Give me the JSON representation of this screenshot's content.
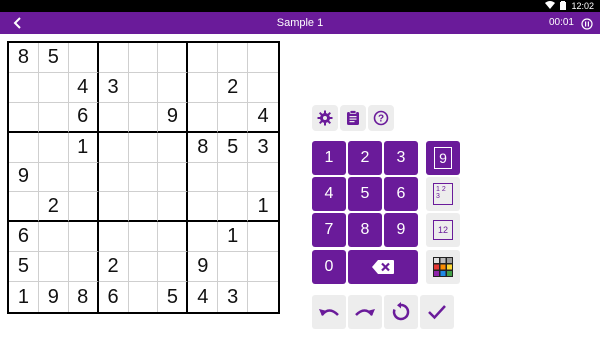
{
  "status_bar": {
    "time": "12:02"
  },
  "app_bar": {
    "title": "Sample 1",
    "timer": "00:01"
  },
  "colors": {
    "accent": "#6a1b9a",
    "button_bg": "#ededed"
  },
  "puzzle": {
    "cells": [
      [
        "8",
        "5",
        "",
        "",
        "",
        "",
        "",
        "",
        ""
      ],
      [
        "",
        "",
        "4",
        "3",
        "",
        "",
        "",
        "2",
        ""
      ],
      [
        "",
        "",
        "6",
        "",
        "",
        "9",
        "",
        "",
        "4"
      ],
      [
        "",
        "",
        "1",
        "",
        "",
        "",
        "8",
        "5",
        "3"
      ],
      [
        "9",
        "",
        "",
        "",
        "",
        "",
        "",
        "",
        ""
      ],
      [
        "",
        "2",
        "",
        "",
        "",
        "",
        "",
        "",
        "1"
      ],
      [
        "6",
        "",
        "",
        "",
        "",
        "",
        "",
        "1",
        ""
      ],
      [
        "5",
        "",
        "",
        "2",
        "",
        "",
        "9",
        "",
        ""
      ],
      [
        "1",
        "9",
        "8",
        "6",
        "",
        "5",
        "4",
        "3",
        ""
      ]
    ]
  },
  "keypad": {
    "digits": [
      "1",
      "2",
      "3",
      "4",
      "5",
      "6",
      "7",
      "8",
      "9",
      "0"
    ],
    "mode_buttons": [
      {
        "label": "9",
        "icon": "big-number-mode-icon",
        "active": true
      },
      {
        "label": "1 2 3",
        "icon": "pencil-marks-mode-icon",
        "active": false
      },
      {
        "label": "12",
        "icon": "number-mode-icon",
        "active": false
      },
      {
        "label": "",
        "icon": "color-palette-icon",
        "active": false
      }
    ]
  },
  "toolbar": {
    "icons": [
      "gear-icon",
      "clipboard-icon",
      "help-icon"
    ]
  },
  "bottom_actions": {
    "icons": [
      "undo-icon",
      "redo-icon",
      "restart-icon",
      "check-icon"
    ]
  }
}
